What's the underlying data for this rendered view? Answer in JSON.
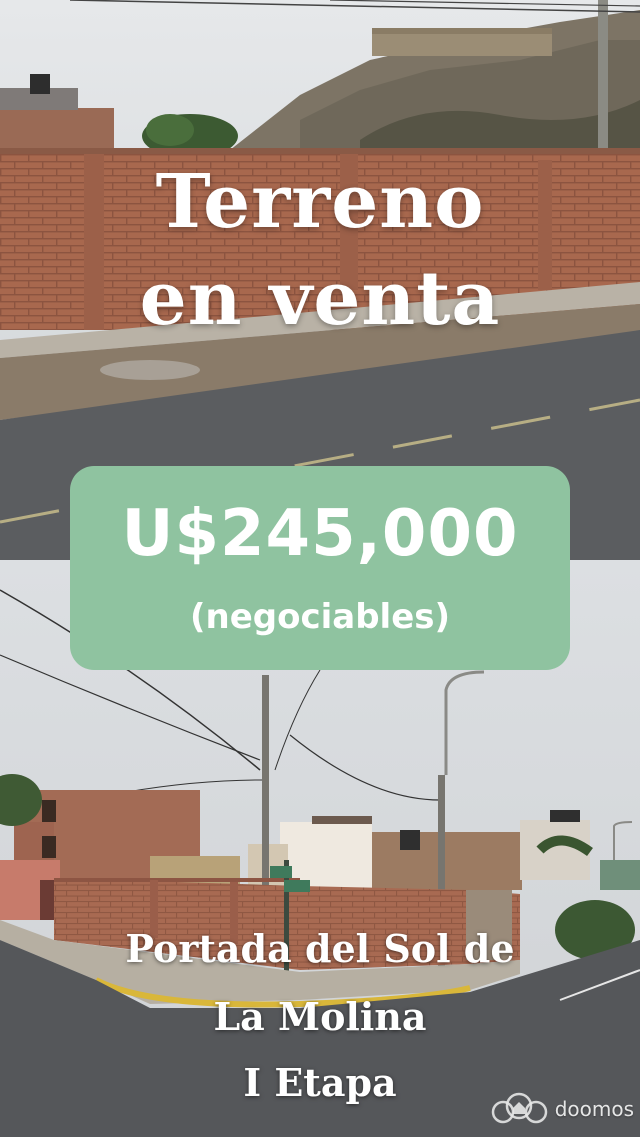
{
  "listing": {
    "headline_line1": "Terreno",
    "headline_line2": "en venta",
    "price": "U$245,000",
    "price_note": "(negociables)",
    "location_line1": "Portada del Sol de",
    "location_line2": "La Molina",
    "location_line3": "I Etapa"
  },
  "watermark": {
    "brand": "doomos",
    "icon": "doomos-logo-icon"
  },
  "colors": {
    "price_card": "#8fc3a0",
    "text": "#ffffff",
    "brick_wall": "#a9694f",
    "road": "#5b5d60",
    "sky": "#d7dadd"
  }
}
